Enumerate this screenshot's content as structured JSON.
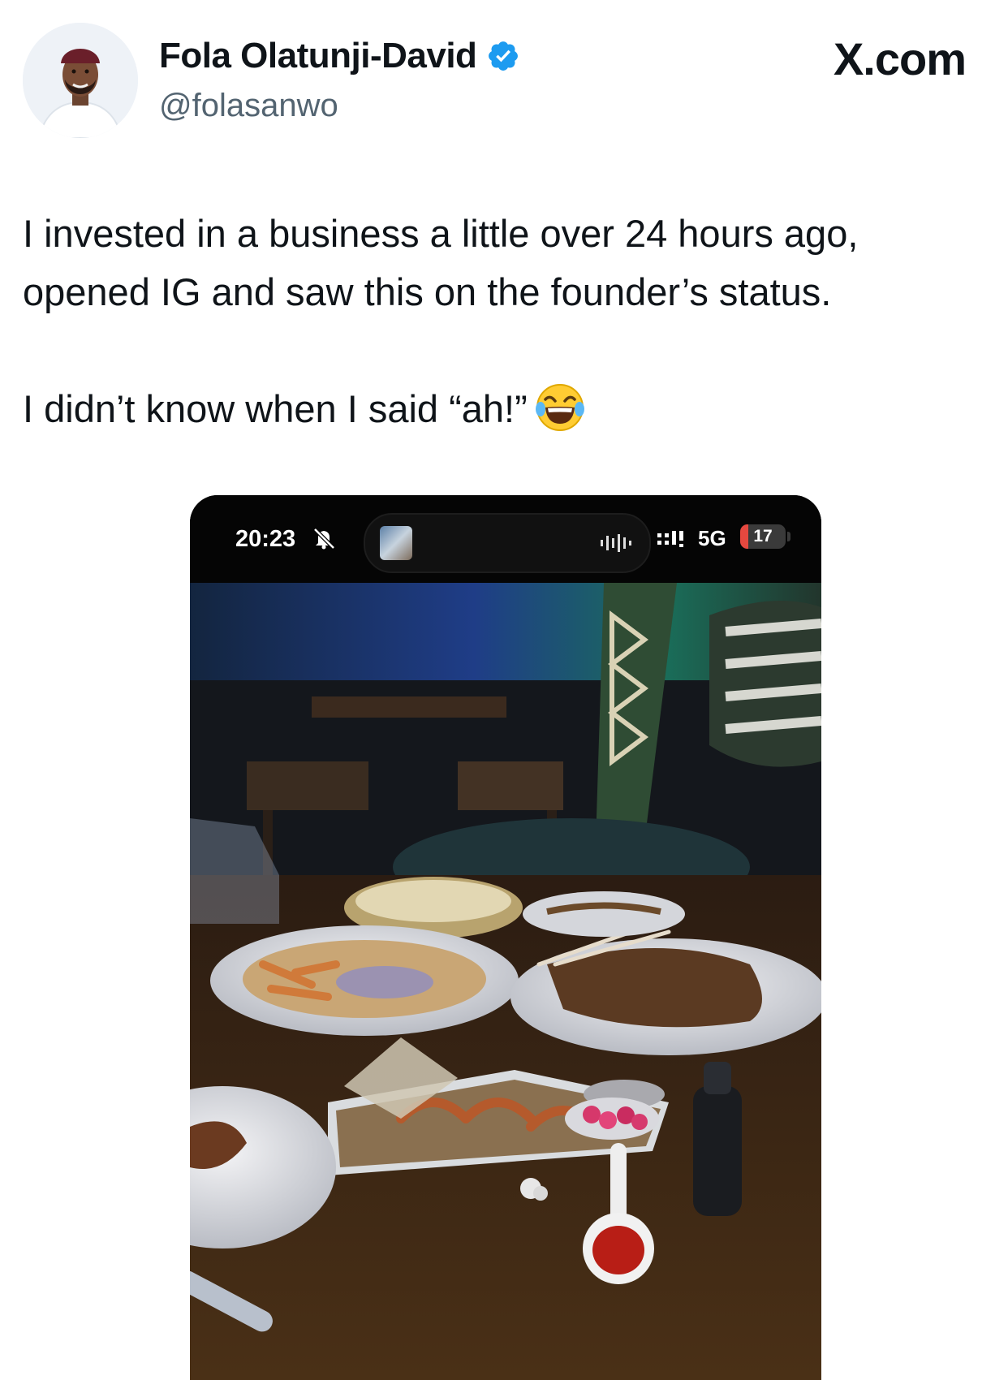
{
  "author": {
    "display_name": "Fola Olatunji-David",
    "handle": "@folasanwo",
    "verified": true,
    "verified_color": "#1d9bf0"
  },
  "site_label": "X.com",
  "tweet": {
    "paragraph_1": "I invested in a business a little over 24 hours ago, opened IG and saw this on the founder’s status.",
    "paragraph_2": "I didn’t know when I said “ah!”",
    "emoji": "face-with-tears-of-joy"
  },
  "media": {
    "status_bar": {
      "time": "20:23",
      "network": "5G",
      "battery": "17",
      "battery_level_percent": 17,
      "battery_color": "#e5483f"
    },
    "description_icons": [
      "bell-off-icon",
      "waveform-icon",
      "signal-icon"
    ]
  }
}
